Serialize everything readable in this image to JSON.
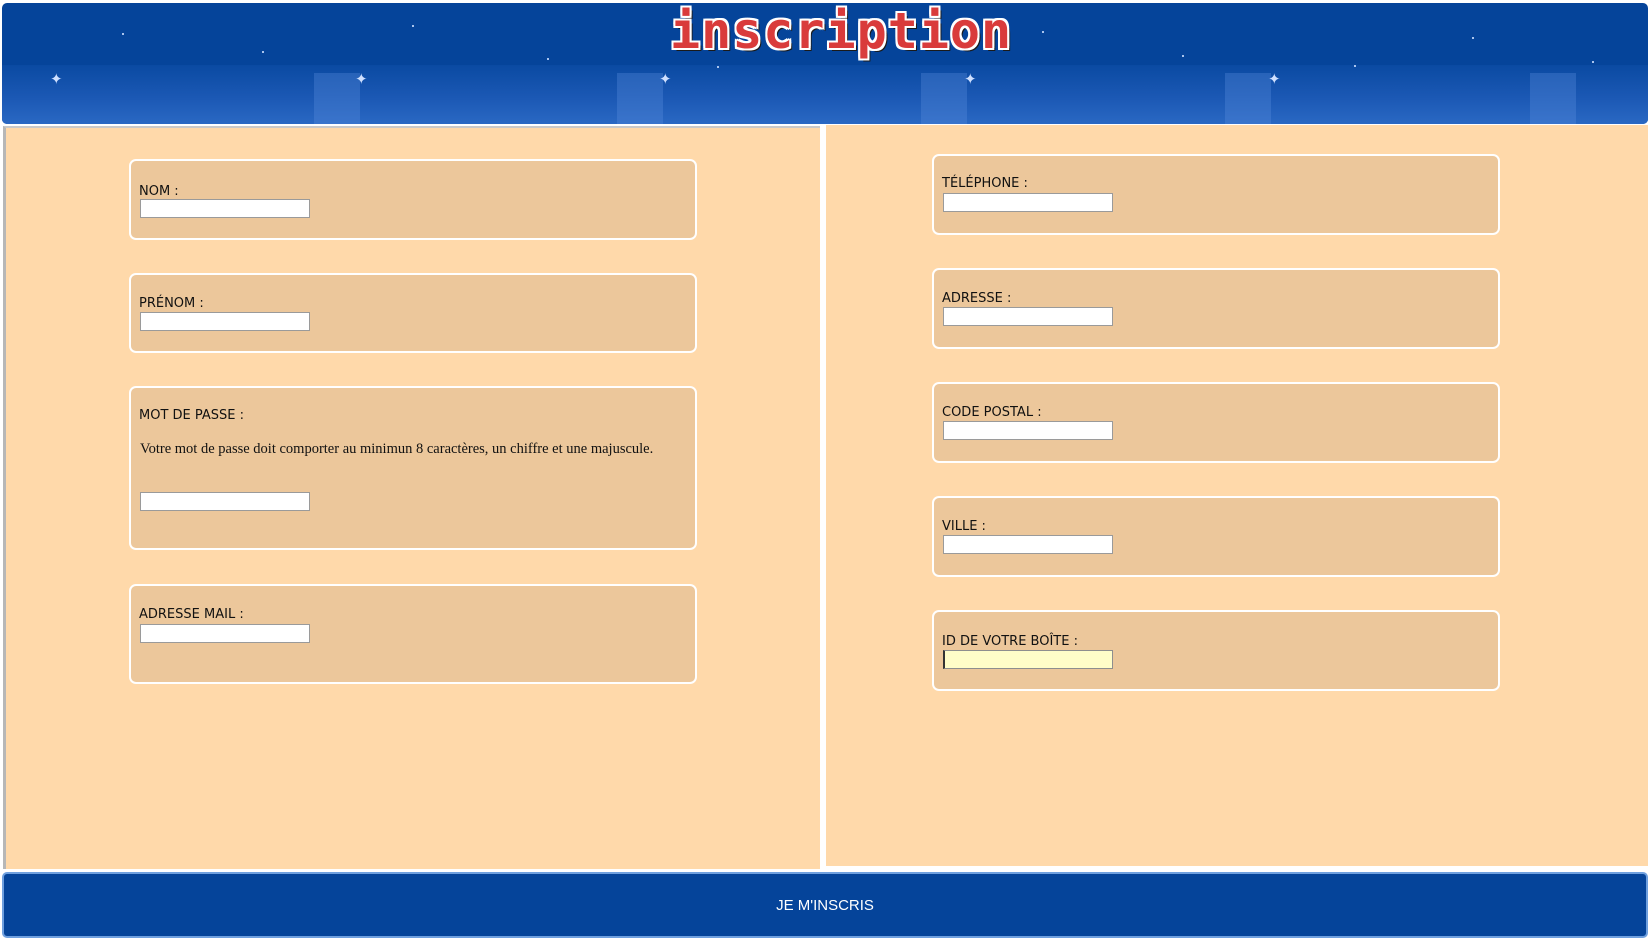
{
  "header": {
    "title": "inscription"
  },
  "left_panel": {
    "fields": [
      {
        "label": "NOM :",
        "value": ""
      },
      {
        "label": "PRÉNOM :",
        "value": ""
      },
      {
        "label": "MOT DE PASSE :",
        "value": "",
        "hint": "Votre mot de passe doit comporter au minimun 8 caractères, un chiffre et une majuscule."
      },
      {
        "label": "ADRESSE MAIL :",
        "value": ""
      }
    ]
  },
  "right_panel": {
    "fields": [
      {
        "label": "TÉLÉPHONE :",
        "value": ""
      },
      {
        "label": "ADRESSE :",
        "value": ""
      },
      {
        "label": "CODE POSTAL :",
        "value": ""
      },
      {
        "label": "VILLE :",
        "value": ""
      },
      {
        "label": "ID DE VOTRE BOÎTE :",
        "value": ""
      }
    ]
  },
  "submit": {
    "label": "JE M'INSCRIS"
  },
  "colors": {
    "header_bg": "#05449a",
    "panel_bg": "#ffd9aa",
    "group_bg": "#ecc79b",
    "title_red": "#d93b3b",
    "active_field_bg": "#fffdc8"
  }
}
